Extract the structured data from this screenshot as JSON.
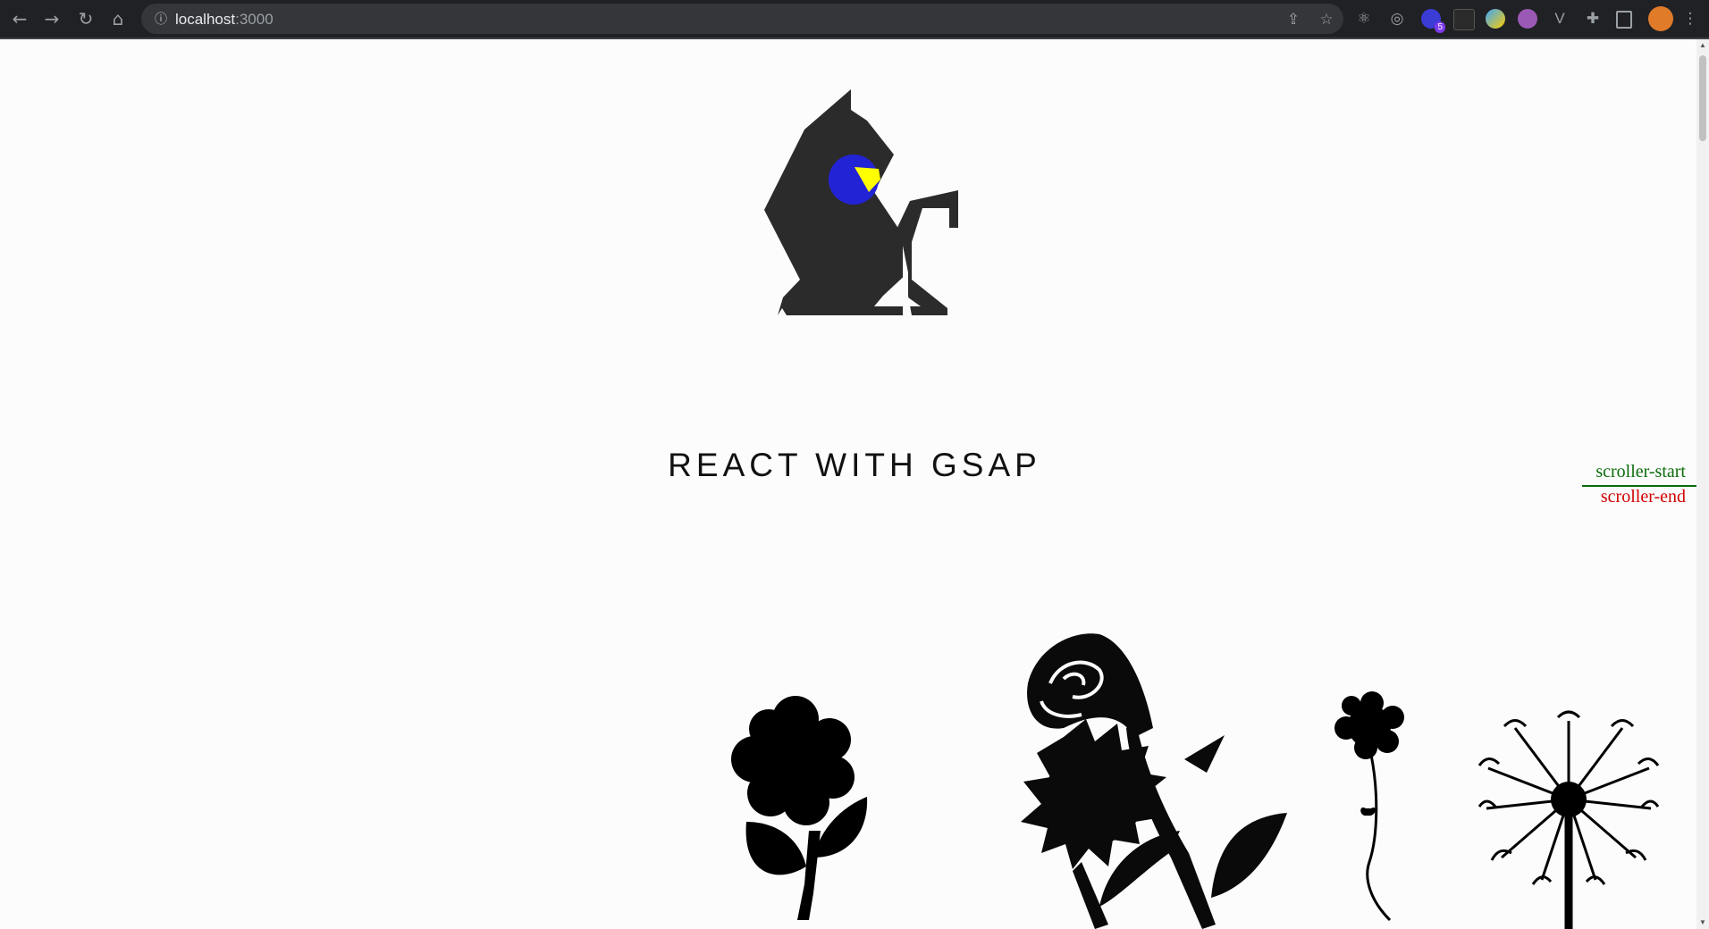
{
  "browser": {
    "url_host": "localhost",
    "url_port": ":3000",
    "extension_badge": "5"
  },
  "page": {
    "title": "REACT WITH GSAP",
    "markers": {
      "start": "scroller-start",
      "end": "scroller-end"
    }
  },
  "colors": {
    "cat": "#2b2b2b",
    "eye": "#2323d6",
    "eye_highlight": "#ffff00",
    "flowers": "#000000",
    "marker_start": "#0a6b0a",
    "marker_end": "#d00000"
  }
}
